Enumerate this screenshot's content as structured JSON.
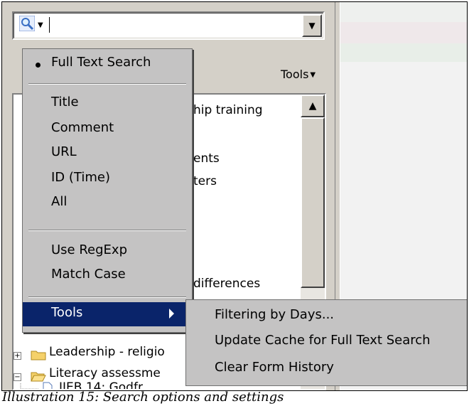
{
  "search": {
    "value": "",
    "tools_label": "Tools"
  },
  "tree": {
    "items": [
      {
        "text": "hip training",
        "expanded": false
      },
      {
        "text": "ents",
        "expanded": false
      },
      {
        "text": "ters",
        "expanded": false
      },
      {
        "text": "differences",
        "expanded": false
      },
      {
        "text": "Leadership - religio",
        "expanded": false
      },
      {
        "text": "Literacy assessme",
        "expanded": true
      },
      {
        "text": "IIEB 14: Godfr",
        "expanded": false
      }
    ]
  },
  "menu": {
    "items": [
      {
        "label": "Full Text Search",
        "checked": true
      },
      {
        "label": "Title"
      },
      {
        "label": "Comment"
      },
      {
        "label": "URL"
      },
      {
        "label": "ID (Time)"
      },
      {
        "label": "All"
      },
      {
        "label": "Use RegExp"
      },
      {
        "label": "Match Case"
      },
      {
        "label": "Tools",
        "submenu": true
      }
    ]
  },
  "submenu": {
    "items": [
      {
        "label": "Filtering by Days..."
      },
      {
        "label": "Update Cache for Full Text Search"
      },
      {
        "label": "Clear Form History"
      }
    ]
  },
  "caption": "Illustration 15: Search options and settings",
  "colors": {
    "highlight": "#0a246a",
    "folder": "#f5d16a",
    "menu_bg": "#c4c3c3"
  },
  "icons": [
    "search-icon",
    "dropdown-arrow-icon",
    "folder-icon",
    "open-folder-icon",
    "document-icon",
    "submenu-arrow-icon",
    "radio-bullet-icon"
  ]
}
